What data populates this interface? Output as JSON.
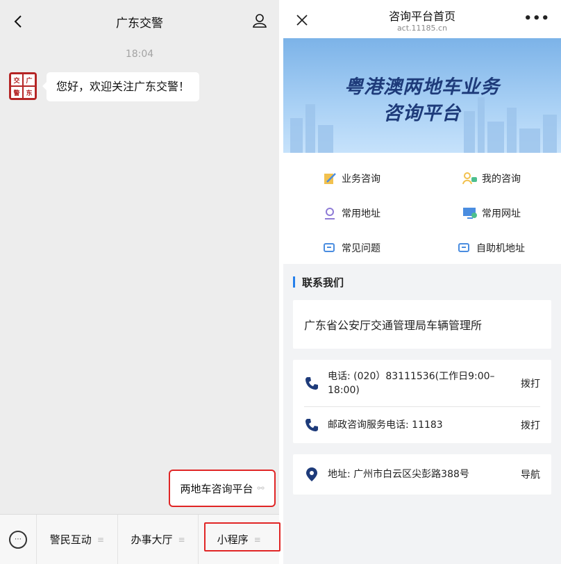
{
  "chat": {
    "title": "广东交警",
    "timestamp": "18:04",
    "avatar_chars": [
      "交",
      "广",
      "警",
      "东"
    ],
    "message": "您好，欢迎关注广东交警！",
    "mini_program_card": "两地车咨询平台",
    "menu": [
      {
        "label": "警民互动",
        "lines": "≡"
      },
      {
        "label": "办事大厅",
        "lines": "≡"
      },
      {
        "label": "小程序",
        "lines": "≡"
      }
    ]
  },
  "mini": {
    "title": "咨询平台首页",
    "domain": "act.11185.cn",
    "more": "•••",
    "banner_line1": "粤港澳两地车业务",
    "banner_line2": "咨询平台",
    "grid": [
      {
        "label": "业务咨询",
        "icon": "edit-icon"
      },
      {
        "label": "我的咨询",
        "icon": "users-icon"
      },
      {
        "label": "常用地址",
        "icon": "location-icon"
      },
      {
        "label": "常用网址",
        "icon": "monitor-icon"
      },
      {
        "label": "常见问题",
        "icon": "chat-icon"
      },
      {
        "label": "自助机地址",
        "icon": "chat-icon"
      }
    ],
    "contact_title": "联系我们",
    "org": "广东省公安厅交通管理局车辆管理所",
    "phone1": "电话: (020）83111536(工作日9:00–18:00)",
    "phone2": "邮政咨询服务电话: 11183",
    "dial": "拨打",
    "address": "地址: 广州市白云区尖彭路388号",
    "navigate": "导航"
  },
  "colors": {
    "accent_blue": "#2680eb",
    "highlight_red": "#e02525",
    "banner_text": "#1e3b7a"
  }
}
